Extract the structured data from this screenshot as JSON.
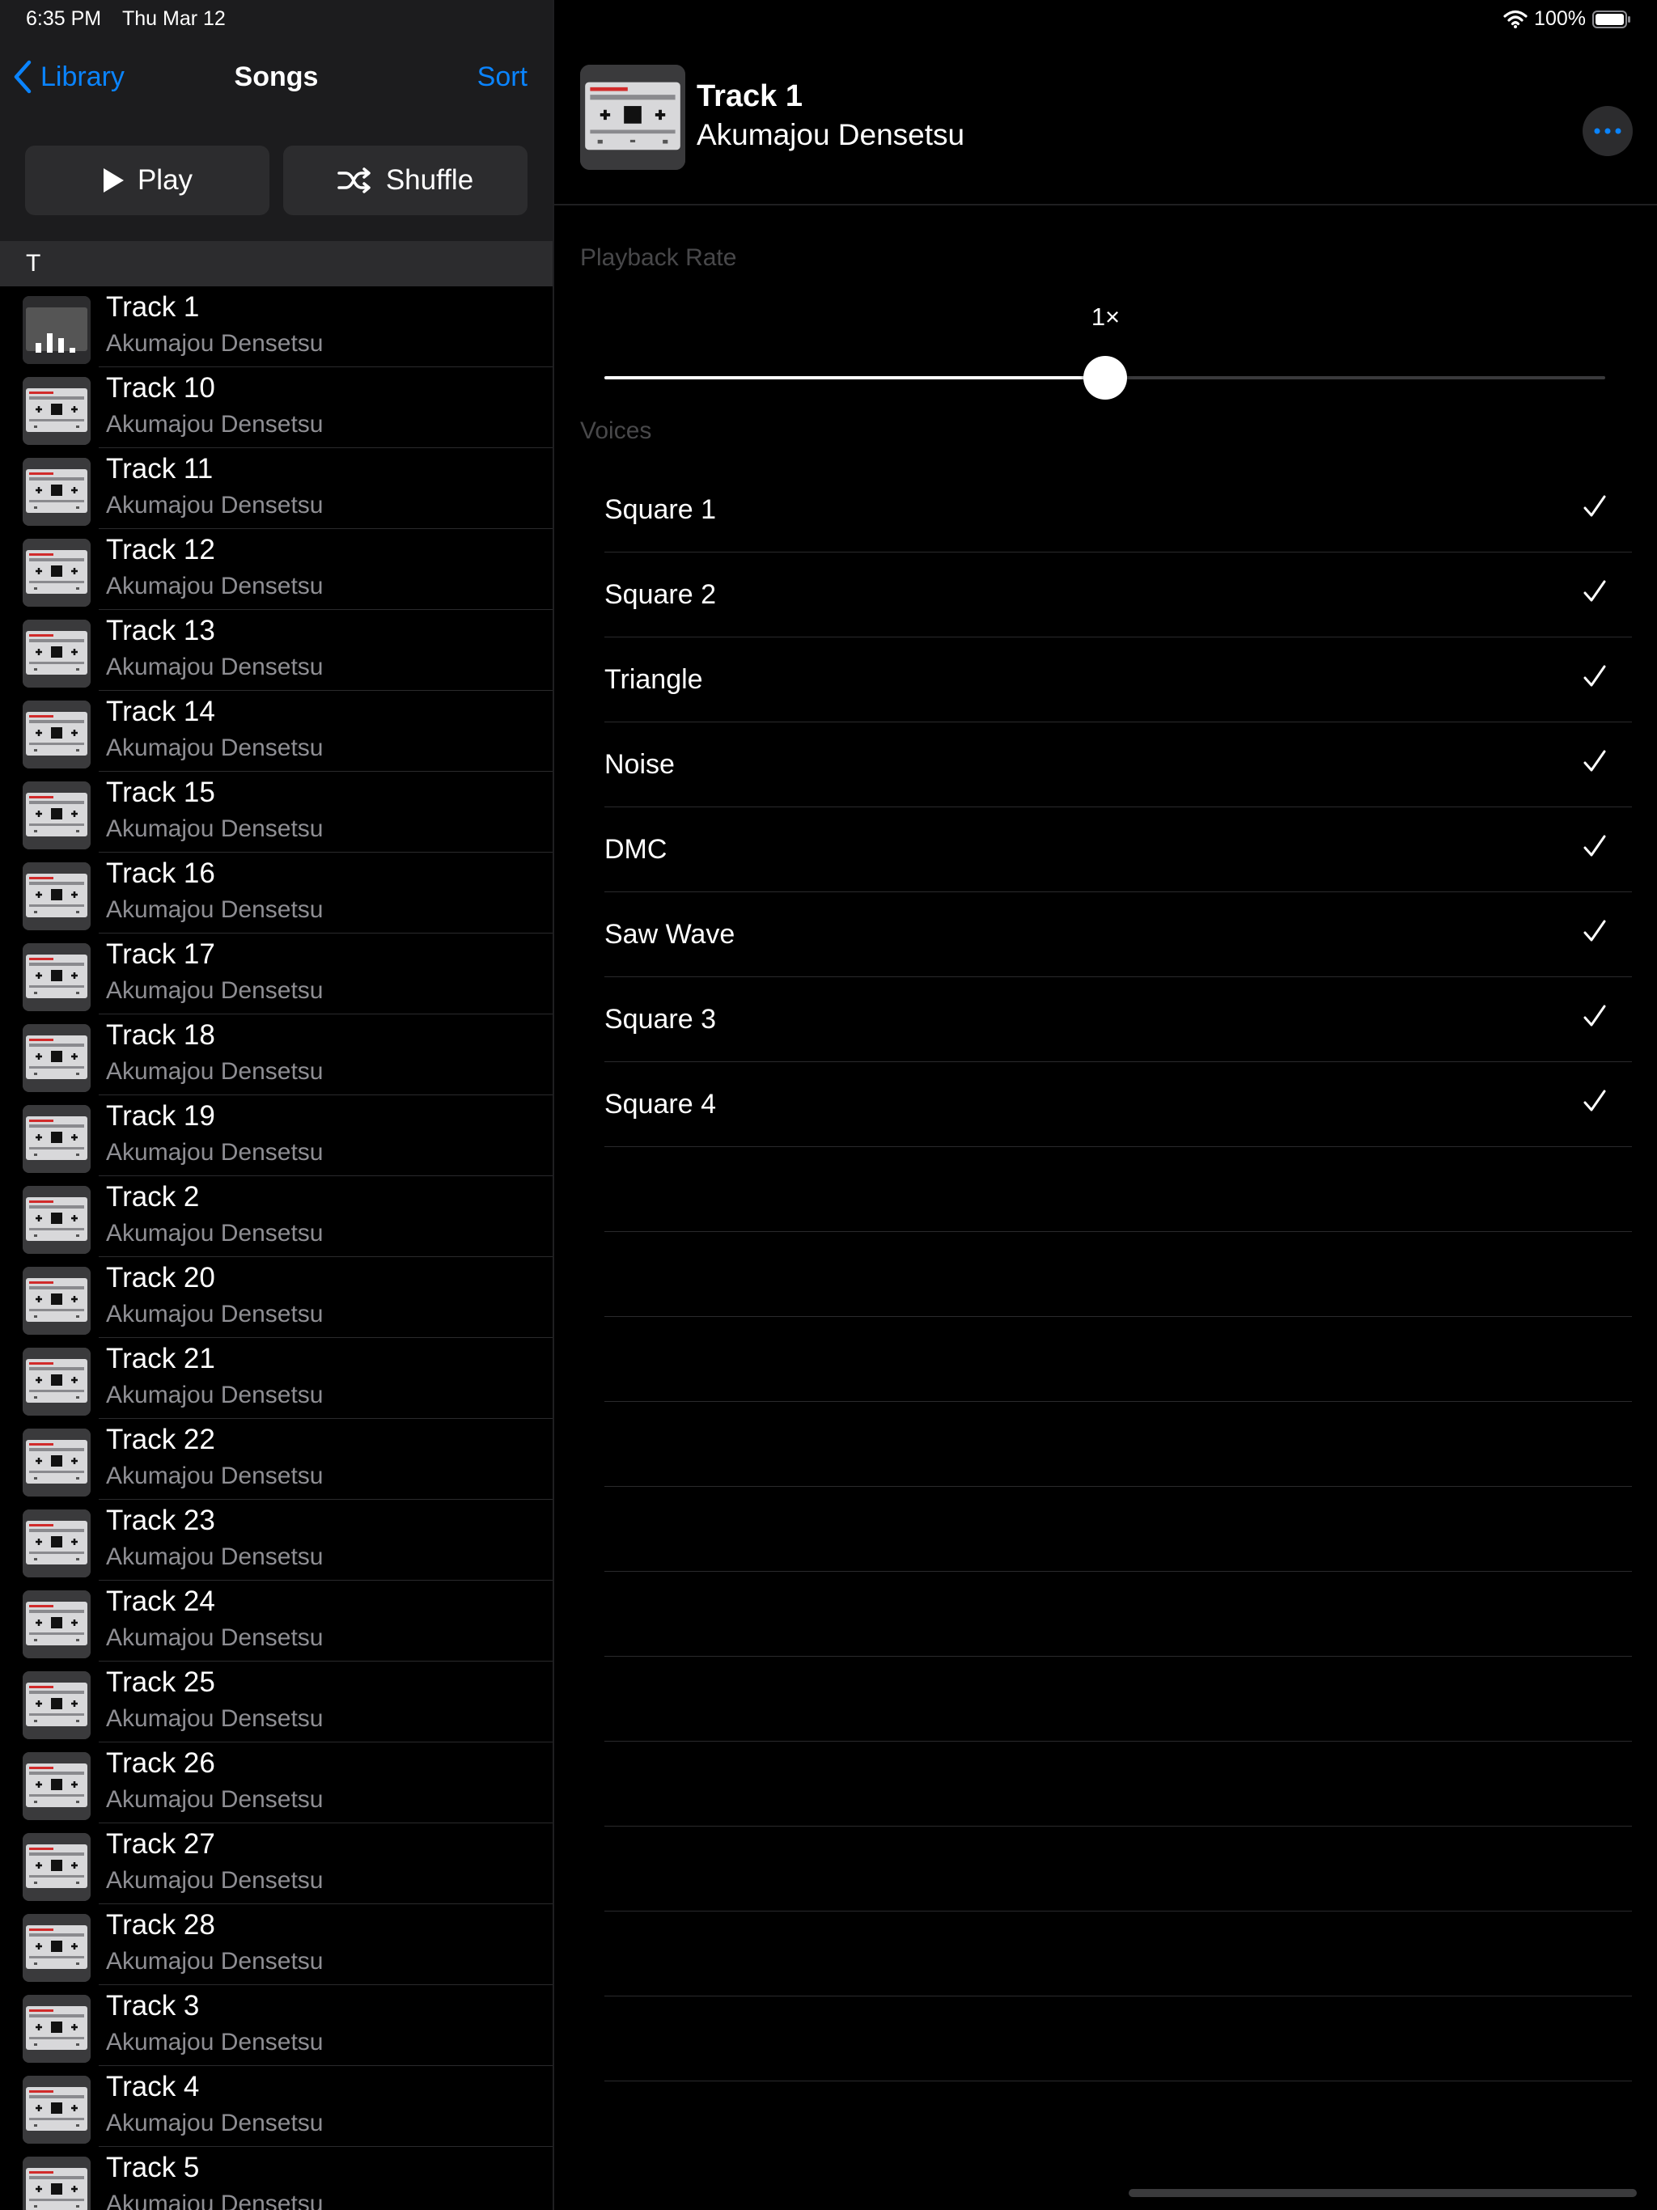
{
  "status_bar": {
    "time": "6:35 PM",
    "date": "Thu Mar 12",
    "battery": "100%"
  },
  "nav": {
    "back_label": "Library",
    "title": "Songs",
    "sort_label": "Sort"
  },
  "actions": {
    "play_label": "Play",
    "shuffle_label": "Shuffle"
  },
  "section": {
    "letter": "T"
  },
  "songs": [
    {
      "title": "Track 1",
      "artist": "Akumajou Densetsu",
      "playing": true
    },
    {
      "title": "Track 10",
      "artist": "Akumajou Densetsu"
    },
    {
      "title": "Track 11",
      "artist": "Akumajou Densetsu"
    },
    {
      "title": "Track 12",
      "artist": "Akumajou Densetsu"
    },
    {
      "title": "Track 13",
      "artist": "Akumajou Densetsu"
    },
    {
      "title": "Track 14",
      "artist": "Akumajou Densetsu"
    },
    {
      "title": "Track 15",
      "artist": "Akumajou Densetsu"
    },
    {
      "title": "Track 16",
      "artist": "Akumajou Densetsu"
    },
    {
      "title": "Track 17",
      "artist": "Akumajou Densetsu"
    },
    {
      "title": "Track 18",
      "artist": "Akumajou Densetsu"
    },
    {
      "title": "Track 19",
      "artist": "Akumajou Densetsu"
    },
    {
      "title": "Track 2",
      "artist": "Akumajou Densetsu"
    },
    {
      "title": "Track 20",
      "artist": "Akumajou Densetsu"
    },
    {
      "title": "Track 21",
      "artist": "Akumajou Densetsu"
    },
    {
      "title": "Track 22",
      "artist": "Akumajou Densetsu"
    },
    {
      "title": "Track 23",
      "artist": "Akumajou Densetsu"
    },
    {
      "title": "Track 24",
      "artist": "Akumajou Densetsu"
    },
    {
      "title": "Track 25",
      "artist": "Akumajou Densetsu"
    },
    {
      "title": "Track 26",
      "artist": "Akumajou Densetsu"
    },
    {
      "title": "Track 27",
      "artist": "Akumajou Densetsu"
    },
    {
      "title": "Track 28",
      "artist": "Akumajou Densetsu"
    },
    {
      "title": "Track 3",
      "artist": "Akumajou Densetsu"
    },
    {
      "title": "Track 4",
      "artist": "Akumajou Densetsu"
    },
    {
      "title": "Track 5",
      "artist": "Akumajou Densetsu"
    }
  ],
  "now_playing": {
    "title": "Track 1",
    "artist": "Akumajou Densetsu"
  },
  "playback_rate": {
    "label": "Playback Rate",
    "value_label": "1×",
    "level": 0.5
  },
  "voices_label": "Voices",
  "voices": [
    {
      "name": "Square 1",
      "checked": true
    },
    {
      "name": "Square 2",
      "checked": true
    },
    {
      "name": "Triangle",
      "checked": true
    },
    {
      "name": "Noise",
      "checked": true
    },
    {
      "name": "DMC",
      "checked": true
    },
    {
      "name": "Saw Wave",
      "checked": true
    },
    {
      "name": "Square 3",
      "checked": true
    },
    {
      "name": "Square 4",
      "checked": true
    }
  ],
  "colors": {
    "accent": "#0a84ff",
    "background": "#000000",
    "secondary_text": "#8e8e93",
    "grouped_bg": "#1c1c1e"
  }
}
